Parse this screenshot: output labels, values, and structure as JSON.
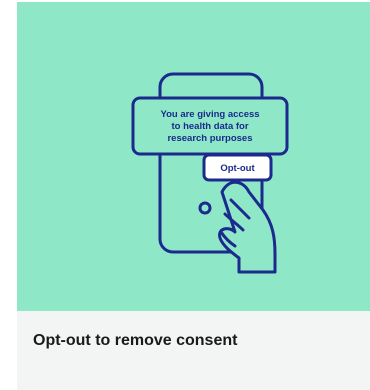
{
  "card": {
    "title": "Opt-out to remove consent",
    "illustration": {
      "background_color": "#8ee8c8",
      "ink_color": "#1b2a8c",
      "message_lines": [
        "You are giving access",
        "to health data for",
        "research purposes"
      ],
      "button_label": "Opt-out"
    }
  }
}
